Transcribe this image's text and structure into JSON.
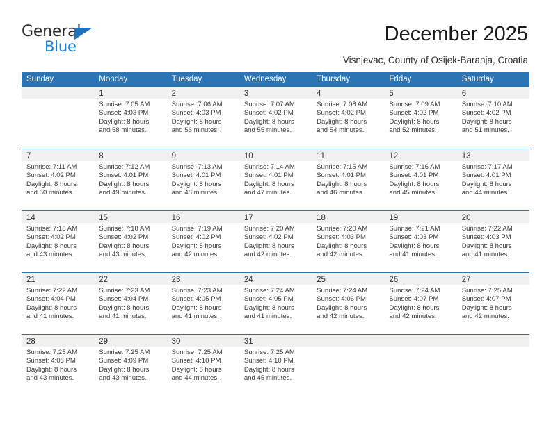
{
  "brand": {
    "name_top": "General",
    "name_bottom": "Blue",
    "accent_color": "#1f7fd4",
    "triangle_color": "#1f72bd"
  },
  "header": {
    "title": "December 2025",
    "subtitle": "Visnjevac, County of Osijek-Baranja, Croatia"
  },
  "theme": {
    "header_blue": "#2c74b3",
    "day_band_gray": "#f0f0f0"
  },
  "weekdays": [
    "Sunday",
    "Monday",
    "Tuesday",
    "Wednesday",
    "Thursday",
    "Friday",
    "Saturday"
  ],
  "weeks": [
    [
      {
        "day": "",
        "sunrise": "",
        "sunset": "",
        "daylight_line1": "",
        "daylight_line2": "",
        "empty": true
      },
      {
        "day": "1",
        "sunrise": "Sunrise: 7:05 AM",
        "sunset": "Sunset: 4:03 PM",
        "daylight_line1": "Daylight: 8 hours",
        "daylight_line2": "and 58 minutes."
      },
      {
        "day": "2",
        "sunrise": "Sunrise: 7:06 AM",
        "sunset": "Sunset: 4:03 PM",
        "daylight_line1": "Daylight: 8 hours",
        "daylight_line2": "and 56 minutes."
      },
      {
        "day": "3",
        "sunrise": "Sunrise: 7:07 AM",
        "sunset": "Sunset: 4:02 PM",
        "daylight_line1": "Daylight: 8 hours",
        "daylight_line2": "and 55 minutes."
      },
      {
        "day": "4",
        "sunrise": "Sunrise: 7:08 AM",
        "sunset": "Sunset: 4:02 PM",
        "daylight_line1": "Daylight: 8 hours",
        "daylight_line2": "and 54 minutes."
      },
      {
        "day": "5",
        "sunrise": "Sunrise: 7:09 AM",
        "sunset": "Sunset: 4:02 PM",
        "daylight_line1": "Daylight: 8 hours",
        "daylight_line2": "and 52 minutes."
      },
      {
        "day": "6",
        "sunrise": "Sunrise: 7:10 AM",
        "sunset": "Sunset: 4:02 PM",
        "daylight_line1": "Daylight: 8 hours",
        "daylight_line2": "and 51 minutes."
      }
    ],
    [
      {
        "day": "7",
        "sunrise": "Sunrise: 7:11 AM",
        "sunset": "Sunset: 4:02 PM",
        "daylight_line1": "Daylight: 8 hours",
        "daylight_line2": "and 50 minutes."
      },
      {
        "day": "8",
        "sunrise": "Sunrise: 7:12 AM",
        "sunset": "Sunset: 4:01 PM",
        "daylight_line1": "Daylight: 8 hours",
        "daylight_line2": "and 49 minutes."
      },
      {
        "day": "9",
        "sunrise": "Sunrise: 7:13 AM",
        "sunset": "Sunset: 4:01 PM",
        "daylight_line1": "Daylight: 8 hours",
        "daylight_line2": "and 48 minutes."
      },
      {
        "day": "10",
        "sunrise": "Sunrise: 7:14 AM",
        "sunset": "Sunset: 4:01 PM",
        "daylight_line1": "Daylight: 8 hours",
        "daylight_line2": "and 47 minutes."
      },
      {
        "day": "11",
        "sunrise": "Sunrise: 7:15 AM",
        "sunset": "Sunset: 4:01 PM",
        "daylight_line1": "Daylight: 8 hours",
        "daylight_line2": "and 46 minutes."
      },
      {
        "day": "12",
        "sunrise": "Sunrise: 7:16 AM",
        "sunset": "Sunset: 4:01 PM",
        "daylight_line1": "Daylight: 8 hours",
        "daylight_line2": "and 45 minutes."
      },
      {
        "day": "13",
        "sunrise": "Sunrise: 7:17 AM",
        "sunset": "Sunset: 4:01 PM",
        "daylight_line1": "Daylight: 8 hours",
        "daylight_line2": "and 44 minutes."
      }
    ],
    [
      {
        "day": "14",
        "sunrise": "Sunrise: 7:18 AM",
        "sunset": "Sunset: 4:02 PM",
        "daylight_line1": "Daylight: 8 hours",
        "daylight_line2": "and 43 minutes."
      },
      {
        "day": "15",
        "sunrise": "Sunrise: 7:18 AM",
        "sunset": "Sunset: 4:02 PM",
        "daylight_line1": "Daylight: 8 hours",
        "daylight_line2": "and 43 minutes."
      },
      {
        "day": "16",
        "sunrise": "Sunrise: 7:19 AM",
        "sunset": "Sunset: 4:02 PM",
        "daylight_line1": "Daylight: 8 hours",
        "daylight_line2": "and 42 minutes."
      },
      {
        "day": "17",
        "sunrise": "Sunrise: 7:20 AM",
        "sunset": "Sunset: 4:02 PM",
        "daylight_line1": "Daylight: 8 hours",
        "daylight_line2": "and 42 minutes."
      },
      {
        "day": "18",
        "sunrise": "Sunrise: 7:20 AM",
        "sunset": "Sunset: 4:03 PM",
        "daylight_line1": "Daylight: 8 hours",
        "daylight_line2": "and 42 minutes."
      },
      {
        "day": "19",
        "sunrise": "Sunrise: 7:21 AM",
        "sunset": "Sunset: 4:03 PM",
        "daylight_line1": "Daylight: 8 hours",
        "daylight_line2": "and 41 minutes."
      },
      {
        "day": "20",
        "sunrise": "Sunrise: 7:22 AM",
        "sunset": "Sunset: 4:03 PM",
        "daylight_line1": "Daylight: 8 hours",
        "daylight_line2": "and 41 minutes."
      }
    ],
    [
      {
        "day": "21",
        "sunrise": "Sunrise: 7:22 AM",
        "sunset": "Sunset: 4:04 PM",
        "daylight_line1": "Daylight: 8 hours",
        "daylight_line2": "and 41 minutes."
      },
      {
        "day": "22",
        "sunrise": "Sunrise: 7:23 AM",
        "sunset": "Sunset: 4:04 PM",
        "daylight_line1": "Daylight: 8 hours",
        "daylight_line2": "and 41 minutes."
      },
      {
        "day": "23",
        "sunrise": "Sunrise: 7:23 AM",
        "sunset": "Sunset: 4:05 PM",
        "daylight_line1": "Daylight: 8 hours",
        "daylight_line2": "and 41 minutes."
      },
      {
        "day": "24",
        "sunrise": "Sunrise: 7:24 AM",
        "sunset": "Sunset: 4:05 PM",
        "daylight_line1": "Daylight: 8 hours",
        "daylight_line2": "and 41 minutes."
      },
      {
        "day": "25",
        "sunrise": "Sunrise: 7:24 AM",
        "sunset": "Sunset: 4:06 PM",
        "daylight_line1": "Daylight: 8 hours",
        "daylight_line2": "and 42 minutes."
      },
      {
        "day": "26",
        "sunrise": "Sunrise: 7:24 AM",
        "sunset": "Sunset: 4:07 PM",
        "daylight_line1": "Daylight: 8 hours",
        "daylight_line2": "and 42 minutes."
      },
      {
        "day": "27",
        "sunrise": "Sunrise: 7:25 AM",
        "sunset": "Sunset: 4:07 PM",
        "daylight_line1": "Daylight: 8 hours",
        "daylight_line2": "and 42 minutes."
      }
    ],
    [
      {
        "day": "28",
        "sunrise": "Sunrise: 7:25 AM",
        "sunset": "Sunset: 4:08 PM",
        "daylight_line1": "Daylight: 8 hours",
        "daylight_line2": "and 43 minutes."
      },
      {
        "day": "29",
        "sunrise": "Sunrise: 7:25 AM",
        "sunset": "Sunset: 4:09 PM",
        "daylight_line1": "Daylight: 8 hours",
        "daylight_line2": "and 43 minutes."
      },
      {
        "day": "30",
        "sunrise": "Sunrise: 7:25 AM",
        "sunset": "Sunset: 4:10 PM",
        "daylight_line1": "Daylight: 8 hours",
        "daylight_line2": "and 44 minutes."
      },
      {
        "day": "31",
        "sunrise": "Sunrise: 7:25 AM",
        "sunset": "Sunset: 4:10 PM",
        "daylight_line1": "Daylight: 8 hours",
        "daylight_line2": "and 45 minutes."
      },
      {
        "day": "",
        "sunrise": "",
        "sunset": "",
        "daylight_line1": "",
        "daylight_line2": "",
        "empty": true
      },
      {
        "day": "",
        "sunrise": "",
        "sunset": "",
        "daylight_line1": "",
        "daylight_line2": "",
        "empty": true
      },
      {
        "day": "",
        "sunrise": "",
        "sunset": "",
        "daylight_line1": "",
        "daylight_line2": "",
        "empty": true
      }
    ]
  ]
}
